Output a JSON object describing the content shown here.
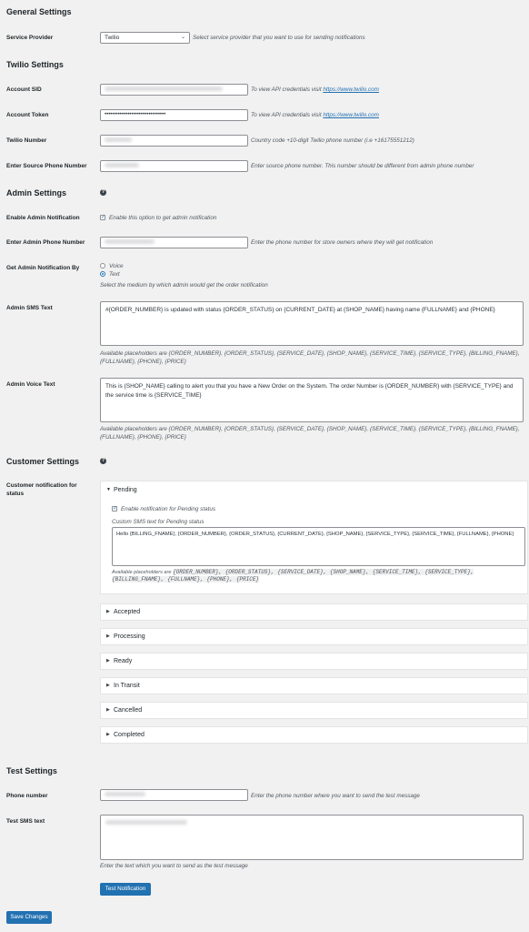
{
  "general": {
    "heading": "General Settings",
    "service_provider": {
      "label": "Service Provider",
      "value": "Twilio",
      "desc": "Select service provider that you want to use for sending notifications"
    }
  },
  "twilio": {
    "heading": "Twilio Settings",
    "account_sid": {
      "label": "Account SID",
      "desc": "To view API credentials visit",
      "link": "https://www.twilio.com"
    },
    "account_token": {
      "label": "Account Token",
      "value": "••••••••••••••••••••••••••••••••",
      "desc": "To view API credentials visit",
      "link": "https://www.twilio.com"
    },
    "twilio_number": {
      "label": "Twilio Number",
      "desc": "Country code +10-digit Twilio phone number (i.e +16175551212)"
    },
    "source_phone": {
      "label": "Enter Source Phone Number",
      "desc": "Enter source phone number. This number should be different from admin phone number"
    }
  },
  "admin": {
    "heading": "Admin Settings",
    "help_icon": "?",
    "enable": {
      "label": "Enable Admin Notification",
      "desc": "Enable this option to get admin notification",
      "checked": true
    },
    "phone": {
      "label": "Enter Admin Phone Number",
      "desc": "Enter the phone number for store owners where they will get notification"
    },
    "notify_by": {
      "label": "Get Admin Notification By",
      "options": [
        "Voice",
        "Text"
      ],
      "selected": "Text",
      "desc": "Select the medium by which admin would get the order notification"
    },
    "sms_text": {
      "label": "Admin SMS Text",
      "value": "#{ORDER_NUMBER} is updated with status {ORDER_STATUS} on {CURRENT_DATE} at {SHOP_NAME} having name {FULLNAME} and {PHONE}",
      "help_line1": "Available placeholders are {ORDER_NUMBER}, {ORDER_STATUS}, {SERVICE_DATE}, {SHOP_NAME}, {SERVICE_TIME}, {SERVICE_TYPE}, {BILLING_FNAME},",
      "help_line2": "{FULLNAME}, {PHONE}, {PRICE}"
    },
    "voice_text": {
      "label": "Admin Voice Text",
      "value": "This is {SHOP_NAME} calling to alert you that you have a New Order on the System. The order Number is {ORDER_NUMBER} with {SERVICE_TYPE} and the service time is {SERVICE_TIME}",
      "help_line1": "Available placeholders are {ORDER_NUMBER}, {ORDER_STATUS}, {SERVICE_DATE}, {SHOP_NAME}, {SERVICE_TIME}, {SERVICE_TYPE}, {BILLING_FNAME},",
      "help_line2": "{FULLNAME}, {PHONE}, {PRICE}"
    }
  },
  "customer": {
    "heading": "Customer Settings",
    "help_icon": "?",
    "label_line1": "Customer notification for",
    "label_line2": "status",
    "pending": {
      "title": "Pending",
      "enable_label": "Enable notification for Pending status",
      "custom_label": "Custom SMS text for Pending status",
      "value": "Hello {BILLING_FNAME}, {ORDER_NUMBER}, {ORDER_STATUS}, {CURRENT_DATE}, {SHOP_NAME}, {SERVICE_TYPE}, {SERVICE_TIME}, {FULLNAME}, {PHONE}",
      "help_prefix": "Available placeholders are",
      "help_code1": "{ORDER_NUMBER}, {ORDER_STATUS}, {SERVICE_DATE}, {SHOP_NAME}, {SERVICE_TIME}, {SERVICE_TYPE},",
      "help_code2": "{BILLING_FNAME}, {FULLNAME}, {PHONE}, {PRICE}"
    },
    "statuses": [
      "Accepted",
      "Processing",
      "Ready",
      "In Transit",
      "Cancelled",
      "Completed"
    ]
  },
  "test": {
    "heading": "Test Settings",
    "phone": {
      "label": "Phone number",
      "desc": "Enter the phone number where you want to send the test message"
    },
    "sms": {
      "label": "Test SMS text",
      "desc": "Enter the text which you want to send as the test message"
    },
    "button": "Test Notification"
  },
  "save_button": "Save Changes",
  "colors": {
    "primary": "#2271b1",
    "background": "#f1f1f1"
  }
}
